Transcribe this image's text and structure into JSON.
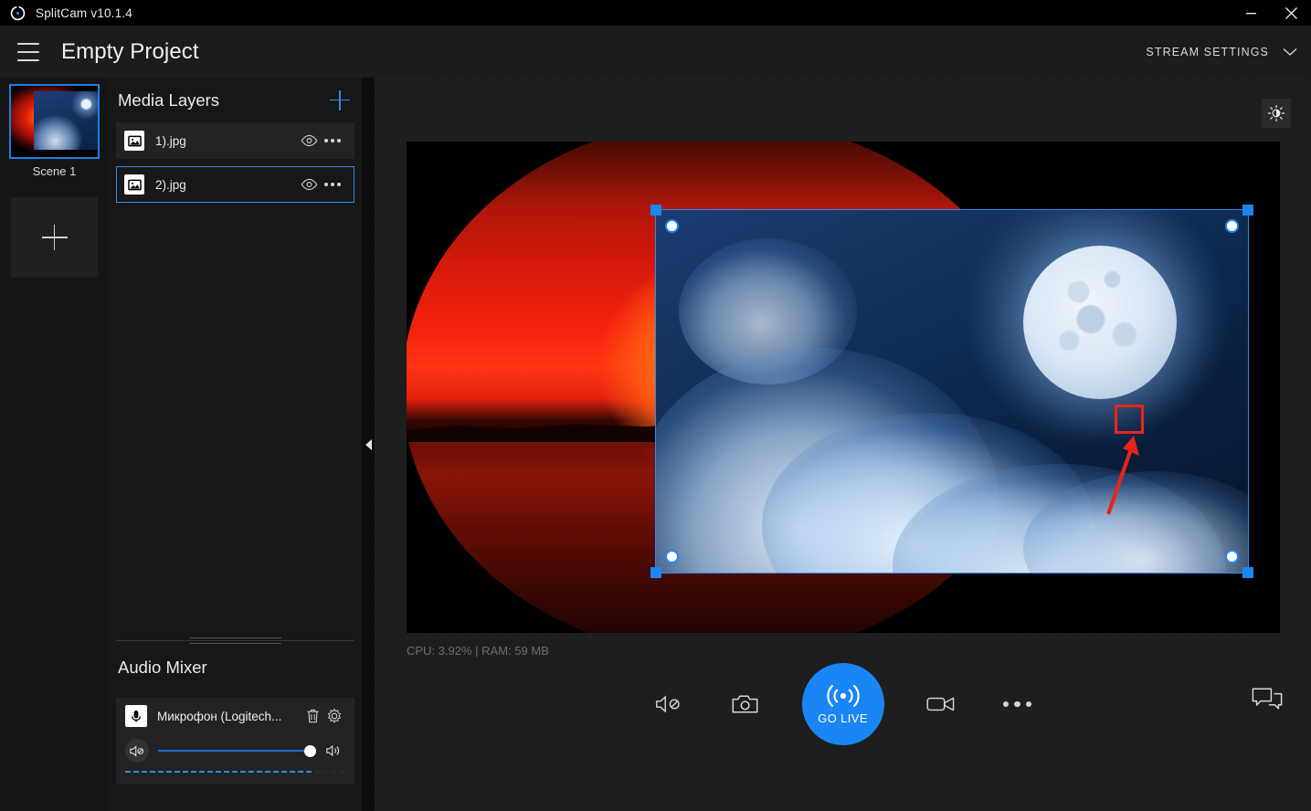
{
  "titlebar": {
    "app_logo_icon": "splitcam-logo-icon",
    "title": "SplitCam v10.1.4",
    "minimize_icon": "minimize-icon",
    "close_icon": "close-icon"
  },
  "header": {
    "menu_icon": "hamburger-menu-icon",
    "project_title": "Empty Project",
    "stream_settings_label": "STREAM SETTINGS",
    "chevron_icon": "chevron-down-icon"
  },
  "scenes": {
    "items": [
      {
        "label": "Scene 1",
        "selected": true
      }
    ],
    "add_icon": "plus-icon"
  },
  "media_layers": {
    "title": "Media Layers",
    "add_icon": "plus-icon",
    "items": [
      {
        "name": "1).jpg",
        "selected": false,
        "icon": "image-icon",
        "visibility_icon": "eye-icon",
        "more_icon": "more-dots-icon"
      },
      {
        "name": "2).jpg",
        "selected": true,
        "icon": "image-icon",
        "visibility_icon": "eye-icon",
        "more_icon": "more-dots-icon"
      }
    ]
  },
  "audio_mixer": {
    "title": "Audio Mixer",
    "channel": {
      "icon": "microphone-icon",
      "name": "Микрофон  (Logitech...",
      "delete_icon": "trash-icon",
      "settings_icon": "gear-icon",
      "mute_icon": "speaker-muted-icon",
      "volume_icon": "speaker-on-icon",
      "volume_percent": 100
    }
  },
  "panel_collapse": {
    "icon": "chevron-left-icon"
  },
  "stage": {
    "brightness_icon": "brightness-icon",
    "status_text": "CPU: 3.92% | RAM: 59 MB",
    "selection": {
      "accent_color": "#2f8ae8",
      "handle_square_color": "#1b87f0",
      "handle_circle_color": "#ffffff"
    },
    "annotation": {
      "color": "#e8251b",
      "box_label": "highlighted-resize-handle",
      "arrow_label": "pointer-arrow"
    }
  },
  "bottom_bar": {
    "buttons": [
      {
        "name": "mute-audio-button",
        "icon": "speaker-muted-icon"
      },
      {
        "name": "snapshot-button",
        "icon": "camera-icon"
      },
      {
        "name": "go-live-button",
        "icon": "broadcast-icon",
        "label": "GO LIVE",
        "color": "#1a86f5"
      },
      {
        "name": "record-button",
        "icon": "video-camera-icon"
      },
      {
        "name": "more-options-button",
        "icon": "more-dots-icon"
      }
    ],
    "chat_button": {
      "name": "chat-button",
      "icon": "chat-bubbles-icon"
    }
  }
}
